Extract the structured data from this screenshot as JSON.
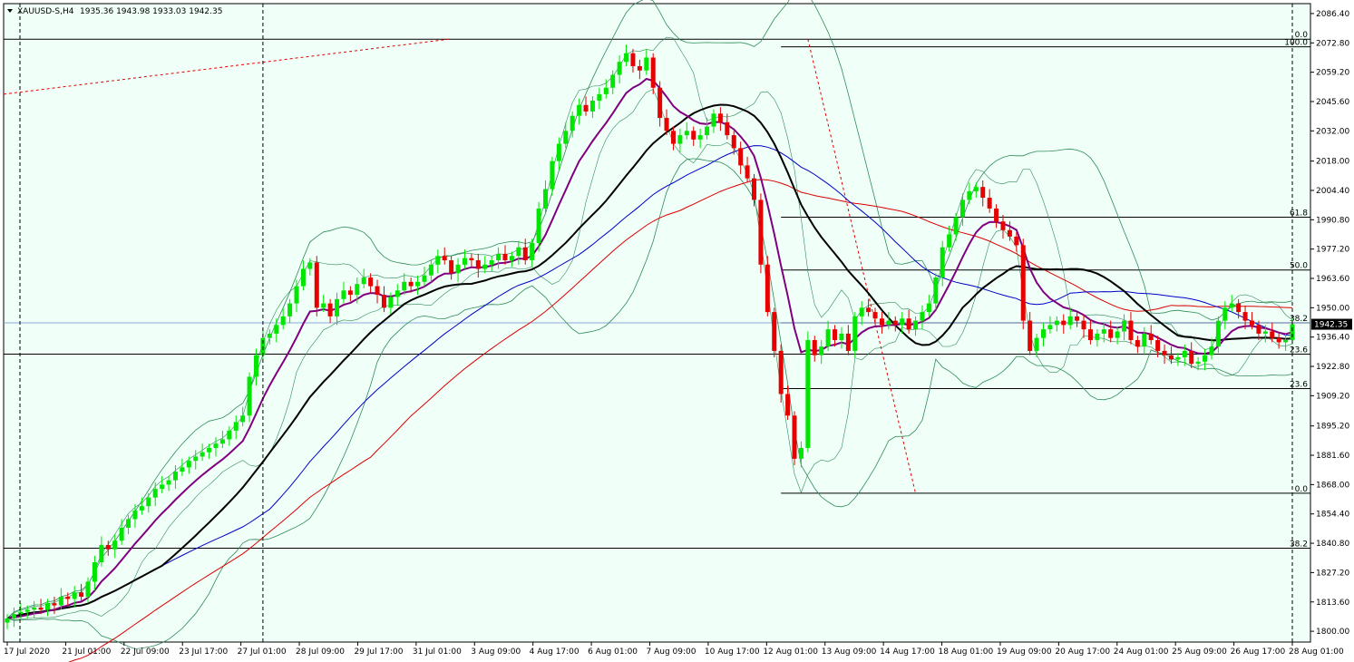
{
  "header": {
    "symbol": "XAUUSD-S,H4",
    "ohlc": "1935.36 1943.98 1933.03 1942.35"
  },
  "colors": {
    "background": "#ffffff",
    "plot_bg": "#f0fff8",
    "bull": "#00e600",
    "bear": "#e60000",
    "sma_black": "#000000",
    "ema_purple": "#800080",
    "ma_blue": "#0000c8",
    "ma_red": "#dc0000",
    "bands": "#2e8b57",
    "grid": "#000000",
    "last_price_bg": "#000000"
  },
  "chart_data": {
    "type": "candlestick",
    "title": "XAUUSD-S,H4",
    "ohlc_last": {
      "open": 1935.36,
      "high": 1943.98,
      "low": 1933.03,
      "close": 1942.35
    },
    "ylim": [
      1795.0,
      2091.0
    ],
    "y_ticks": [
      "2086.40",
      "2072.80",
      "2059.20",
      "2045.60",
      "2032.00",
      "2018.00",
      "2004.40",
      "1990.80",
      "1977.20",
      "1963.60",
      "1950.00",
      "1936.40",
      "1922.80",
      "1909.20",
      "1895.20",
      "1881.60",
      "1868.00",
      "1854.40",
      "1840.80",
      "1827.20",
      "1813.60",
      "1800.00"
    ],
    "x_ticks": [
      "17 Jul 2020",
      "21 Jul 01:00",
      "22 Jul 09:00",
      "23 Jul 17:00",
      "27 Jul 01:00",
      "28 Jul 09:00",
      "29 Jul 17:00",
      "31 Jul 01:00",
      "3 Aug 09:00",
      "4 Aug 17:00",
      "6 Aug 01:00",
      "7 Aug 09:00",
      "10 Aug 17:00",
      "12 Aug 01:00",
      "13 Aug 09:00",
      "14 Aug 17:00",
      "18 Aug 01:00",
      "19 Aug 09:00",
      "20 Aug 17:00",
      "24 Aug 01:00",
      "25 Aug 09:00",
      "26 Aug 17:00",
      "28 Aug 01:00"
    ],
    "vertical_separators": [
      1,
      5,
      10,
      15,
      20
    ],
    "closes": [
      1806,
      1808,
      1809,
      1810,
      1811,
      1810,
      1813,
      1812,
      1816,
      1815,
      1818,
      1816,
      1823,
      1832,
      1840,
      1838,
      1842,
      1848,
      1852,
      1856,
      1858,
      1862,
      1866,
      1868,
      1870,
      1874,
      1876,
      1879,
      1881,
      1883,
      1885,
      1887,
      1889,
      1893,
      1897,
      1900,
      1918,
      1928,
      1936,
      1938,
      1942,
      1946,
      1952,
      1960,
      1968,
      1971,
      1950,
      1952,
      1946,
      1954,
      1958,
      1956,
      1961,
      1964,
      1960,
      1956,
      1950,
      1955,
      1958,
      1962,
      1960,
      1962,
      1965,
      1970,
      1974,
      1972,
      1966,
      1970,
      1973,
      1972,
      1968,
      1970,
      1972,
      1975,
      1972,
      1974,
      1978,
      1972,
      1980,
      1996,
      2005,
      2018,
      2026,
      2032,
      2039,
      2044,
      2041,
      2046,
      2049,
      2052,
      2058,
      2064,
      2068,
      2062,
      2060,
      2066,
      2052,
      2038,
      2032,
      2026,
      2030,
      2032,
      2028,
      2030,
      2034,
      2040,
      2036,
      2030,
      2024,
      2016,
      2010,
      2000,
      1970,
      1948,
      1930,
      1910,
      1900,
      1880,
      1885,
      1935,
      1928,
      1932,
      1940,
      1935,
      1938,
      1930,
      1946,
      1950,
      1948,
      1945,
      1942,
      1944,
      1942,
      1945,
      1940,
      1944,
      1948,
      1952,
      1964,
      1978,
      1984,
      1992,
      2000,
      2004,
      2006,
      2001,
      1996,
      1990,
      1986,
      1983,
      1979,
      1944,
      1930,
      1936,
      1940,
      1942,
      1944,
      1942,
      1946,
      1944,
      1940,
      1935,
      1938,
      1940,
      1936,
      1939,
      1944,
      1935,
      1932,
      1938,
      1935,
      1930,
      1928,
      1926,
      1927,
      1930,
      1924,
      1925,
      1928,
      1932,
      1944,
      1950,
      1952,
      1948,
      1944,
      1942,
      1938,
      1939,
      1936,
      1934,
      1935,
      1942.35
    ],
    "fibonacci_levels": [
      {
        "label": "0.0",
        "price": 2074.5
      },
      {
        "label": "100.0",
        "price": 2071.0
      },
      {
        "label": "61.8",
        "price": 1992.0
      },
      {
        "label": "50.0",
        "price": 1967.5
      },
      {
        "label": "38.2",
        "price": 1943.0
      },
      {
        "label": "23.6",
        "price": 1928.5
      },
      {
        "label": "23.6",
        "price": 1912.5
      },
      {
        "label": "0.0",
        "price": 1864.0
      },
      {
        "label": "38.2",
        "price": 1838.5
      }
    ],
    "current_price": 1942.35,
    "horizontal_guides": [
      2074.5,
      1928.5,
      1838.5
    ],
    "blue_price_line": 1943.0
  }
}
